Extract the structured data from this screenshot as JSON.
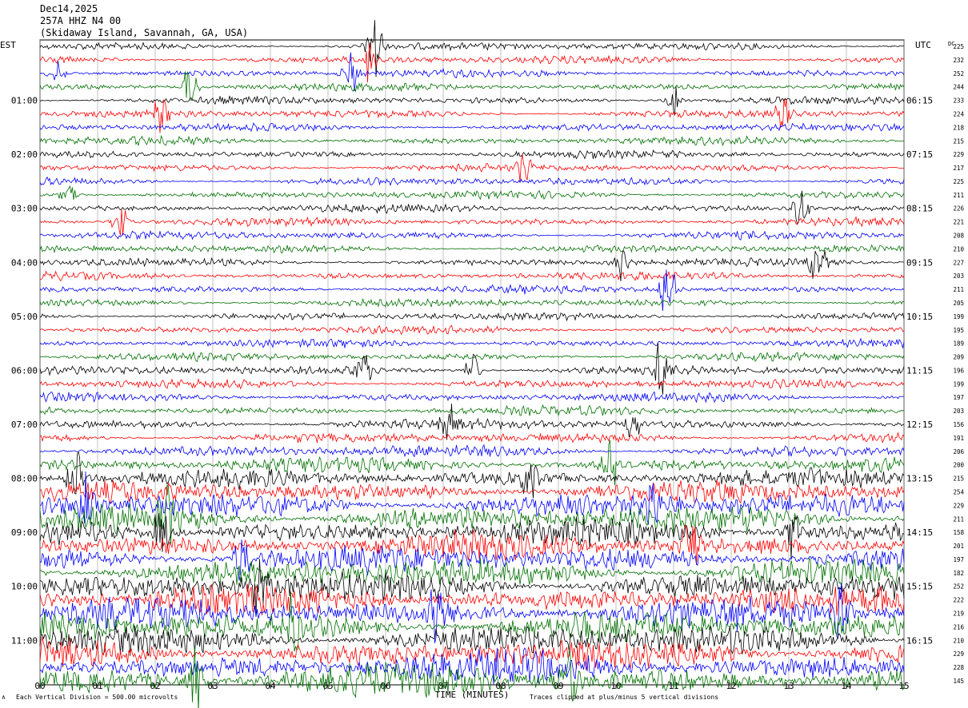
{
  "header": {
    "date": "Dec14,2025",
    "station": "257A HHZ N4 00",
    "location": "(Skidaway Island, Savannah, GA, USA)"
  },
  "left_axis_title": "EST",
  "right_axis_title": "UTC",
  "dc_title": "DC",
  "footer": {
    "vertical_division": "Each Vertical Division =  500.00 microvolts",
    "clip_note": "Traces clipped at plus/minus 5 vertical divisions"
  },
  "chart_data": {
    "type": "line",
    "title": "",
    "xlabel": "TIME (MINUTES)",
    "ylabel": "",
    "xlim": [
      0,
      15
    ],
    "x_ticks": [
      "00",
      "01",
      "02",
      "03",
      "04",
      "05",
      "06",
      "07",
      "08",
      "09",
      "10",
      "11",
      "12",
      "13",
      "14",
      "15"
    ],
    "grid": true,
    "trace_colors": [
      "#000000",
      "#ff0000",
      "#0000ff",
      "#007000"
    ],
    "trace_count": 48,
    "left_hour_labels": [
      "01:00",
      "02:00",
      "03:00",
      "04:00",
      "05:00",
      "06:00",
      "07:00",
      "08:00",
      "09:00",
      "10:00",
      "11:00"
    ],
    "right_hour_labels": [
      "06:15",
      "07:15",
      "08:15",
      "09:15",
      "10:15",
      "11:15",
      "12:15",
      "13:15",
      "14:15",
      "15:15",
      "16:15"
    ],
    "dc_offsets": [
      225,
      232,
      252,
      244,
      233,
      224,
      218,
      215,
      229,
      217,
      225,
      211,
      226,
      221,
      208,
      210,
      227,
      203,
      211,
      205,
      199,
      195,
      189,
      209,
      196,
      199,
      197,
      203,
      156,
      191,
      206,
      200,
      215,
      254,
      229,
      211,
      158,
      201,
      197,
      182,
      252,
      222,
      219,
      216,
      210,
      229,
      228,
      145
    ],
    "trace_amplitude": [
      0.3,
      0.3,
      0.3,
      0.3,
      0.3,
      0.3,
      0.3,
      0.3,
      0.3,
      0.3,
      0.3,
      0.3,
      0.3,
      0.3,
      0.3,
      0.3,
      0.3,
      0.3,
      0.3,
      0.3,
      0.3,
      0.3,
      0.3,
      0.3,
      0.35,
      0.35,
      0.35,
      0.35,
      0.4,
      0.4,
      0.45,
      0.55,
      0.7,
      0.8,
      0.95,
      1.05,
      1.0,
      1.0,
      1.05,
      1.1,
      1.1,
      1.1,
      1.15,
      1.15,
      1.15,
      1.15,
      1.2,
      1.25
    ],
    "events": [
      {
        "trace": 0,
        "minute": 5.8,
        "amplitude": 2.8
      },
      {
        "trace": 1,
        "minute": 5.7,
        "amplitude": 1.5
      },
      {
        "trace": 2,
        "minute": 0.3,
        "amplitude": 1.2
      },
      {
        "trace": 2,
        "minute": 5.4,
        "amplitude": 1.4
      },
      {
        "trace": 3,
        "minute": 2.6,
        "amplitude": 1.6
      },
      {
        "trace": 4,
        "minute": 11.0,
        "amplitude": 1.2
      },
      {
        "trace": 5,
        "minute": 2.1,
        "amplitude": 1.1
      },
      {
        "trace": 5,
        "minute": 12.9,
        "amplitude": 1.0
      },
      {
        "trace": 9,
        "minute": 8.4,
        "amplitude": 1.2
      },
      {
        "trace": 11,
        "minute": 0.5,
        "amplitude": 1.0
      },
      {
        "trace": 12,
        "minute": 13.2,
        "amplitude": 1.6
      },
      {
        "trace": 13,
        "minute": 1.4,
        "amplitude": 1.5
      },
      {
        "trace": 16,
        "minute": 10.1,
        "amplitude": 1.5
      },
      {
        "trace": 16,
        "minute": 13.5,
        "amplitude": 1.8
      },
      {
        "trace": 18,
        "minute": 10.9,
        "amplitude": 2.2
      },
      {
        "trace": 24,
        "minute": 5.6,
        "amplitude": 1.3
      },
      {
        "trace": 24,
        "minute": 7.5,
        "amplitude": 1.2
      },
      {
        "trace": 24,
        "minute": 10.8,
        "amplitude": 2.0
      },
      {
        "trace": 28,
        "minute": 7.1,
        "amplitude": 1.1
      },
      {
        "trace": 28,
        "minute": 10.3,
        "amplitude": 1.0
      },
      {
        "trace": 31,
        "minute": 9.9,
        "amplitude": 1.5
      },
      {
        "trace": 32,
        "minute": 0.6,
        "amplitude": 2.0
      },
      {
        "trace": 32,
        "minute": 8.5,
        "amplitude": 1.6
      },
      {
        "trace": 34,
        "minute": 0.8,
        "amplitude": 1.8
      },
      {
        "trace": 34,
        "minute": 10.6,
        "amplitude": 1.8
      },
      {
        "trace": 35,
        "minute": 2.2,
        "amplitude": 2.0
      },
      {
        "trace": 36,
        "minute": 2.1,
        "amplitude": 2.2
      },
      {
        "trace": 36,
        "minute": 13.1,
        "amplitude": 1.8
      },
      {
        "trace": 37,
        "minute": 11.3,
        "amplitude": 2.2
      },
      {
        "trace": 38,
        "minute": 3.5,
        "amplitude": 1.6
      },
      {
        "trace": 40,
        "minute": 3.8,
        "amplitude": 1.8
      },
      {
        "trace": 42,
        "minute": 6.9,
        "amplitude": 2.0
      },
      {
        "trace": 42,
        "minute": 13.9,
        "amplitude": 2.2
      },
      {
        "trace": 43,
        "minute": 4.4,
        "amplitude": 1.6
      },
      {
        "trace": 47,
        "minute": 2.7,
        "amplitude": 2.2
      },
      {
        "trace": 47,
        "minute": 9.2,
        "amplitude": 2.0
      }
    ]
  }
}
